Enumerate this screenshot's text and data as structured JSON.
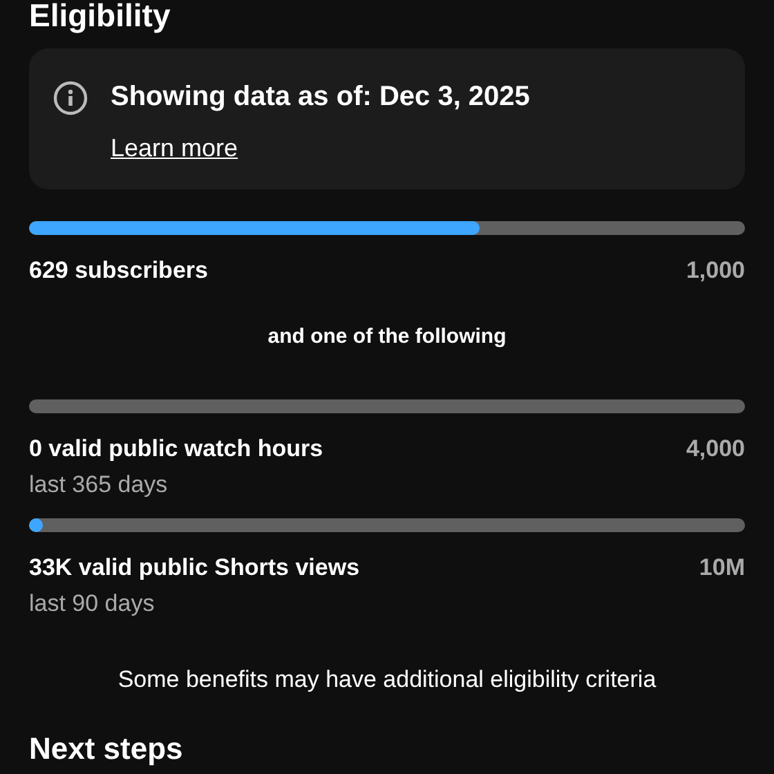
{
  "section_title": "Eligibility",
  "info_card": {
    "text": "Showing data as of: Dec 3, 2025",
    "link": "Learn more"
  },
  "requirements": [
    {
      "level": 0.629,
      "label": "629 subscribers",
      "target": "1,000"
    },
    {
      "kind": "separator",
      "text": "and one of the following"
    },
    {
      "label": "0 valid public watch hours",
      "target": "4,000",
      "period": "last 365 days"
    },
    {
      "level": 0.0033,
      "label": "33K valid public Shorts views",
      "target": "10M",
      "period": "last 90 days"
    }
  ],
  "footnote": "Some benefits may have additional eligibility criteria",
  "next_section_title": "Next steps"
}
